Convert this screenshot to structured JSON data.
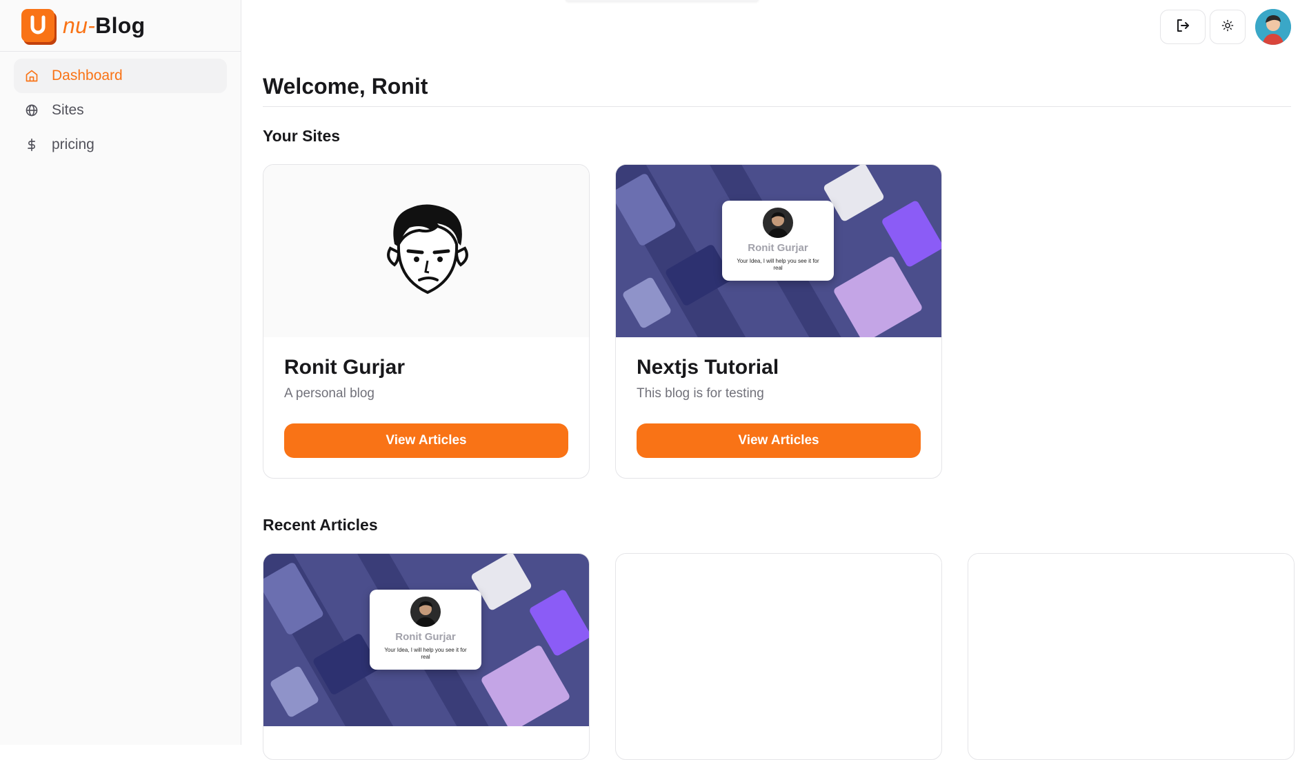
{
  "brand": {
    "prefix": "nu",
    "sep": "-",
    "name": "Blog"
  },
  "sidebar": {
    "items": [
      {
        "label": "Dashboard",
        "icon": "home-icon",
        "active": true
      },
      {
        "label": "Sites",
        "icon": "globe-icon",
        "active": false
      },
      {
        "label": "pricing",
        "icon": "dollar-icon",
        "active": false
      }
    ]
  },
  "topbar": {
    "logout_icon": "logout-icon",
    "theme_icon": "sun-icon",
    "avatar": "user-avatar"
  },
  "main": {
    "title": "Welcome, Ronit",
    "sites_heading": "Your Sites",
    "articles_heading": "Recent Articles",
    "sites": [
      {
        "title": "Ronit Gurjar",
        "description": "A personal blog",
        "button": "View Articles"
      },
      {
        "title": "Nextjs Tutorial",
        "description": "This blog is for testing",
        "button": "View Articles"
      }
    ],
    "mock_profile": {
      "name": "Ronit Gurjar",
      "tagline": "Your Idea, I will help you see it for real"
    }
  },
  "colors": {
    "accent": "#f97316",
    "mockup_bg": "#4b4e8c"
  }
}
